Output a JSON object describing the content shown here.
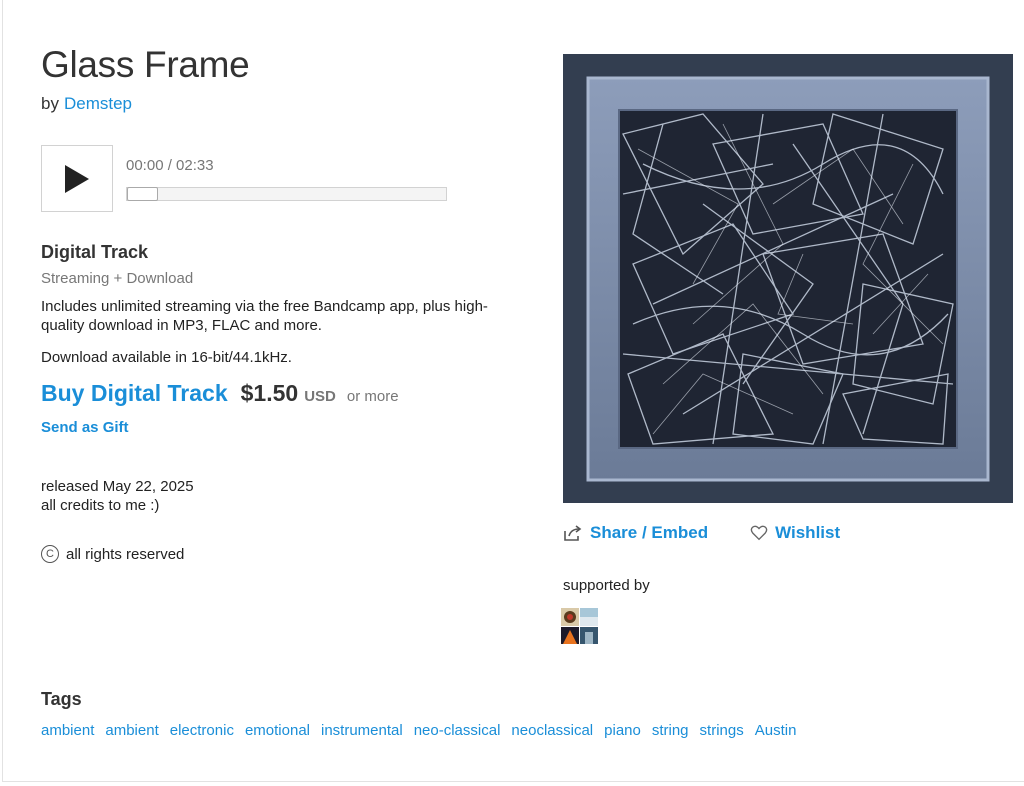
{
  "track": {
    "title": "Glass Frame",
    "by_text": "by",
    "artist": "Demstep"
  },
  "player": {
    "time": "00:00 / 02:33",
    "progress": 0
  },
  "digital": {
    "heading": "Digital Track",
    "subheading": "Streaming + Download",
    "includes": "Includes unlimited streaming via the free Bandcamp app, plus high-quality download in MP3, FLAC and more.",
    "download_info": "Download available in 16-bit/44.1kHz.",
    "buy_label": "Buy Digital Track",
    "price": "$1.50",
    "currency": "USD",
    "or_more": "or more",
    "gift_label": "Send as Gift"
  },
  "credits": {
    "released": "released May 22, 2025",
    "note": "all credits to me :)",
    "rights": "all rights reserved"
  },
  "actions": {
    "share_label": "Share / Embed",
    "wishlist_label": "Wishlist"
  },
  "supporters": {
    "heading": "supported by"
  },
  "tags": {
    "heading": "Tags",
    "items": [
      "ambient",
      "ambient",
      "electronic",
      "emotional",
      "instrumental",
      "neo-classical",
      "neoclassical",
      "piano",
      "string",
      "strings",
      "Austin"
    ]
  },
  "colors": {
    "link": "#1a8ed8",
    "art_background": "#333e50",
    "art_frame": "#7a8aa6",
    "art_inner": "#1f2533"
  },
  "icons": {
    "play": "play-icon",
    "share": "share-icon",
    "wishlist": "heart-icon",
    "rights": "copyright-icon"
  }
}
